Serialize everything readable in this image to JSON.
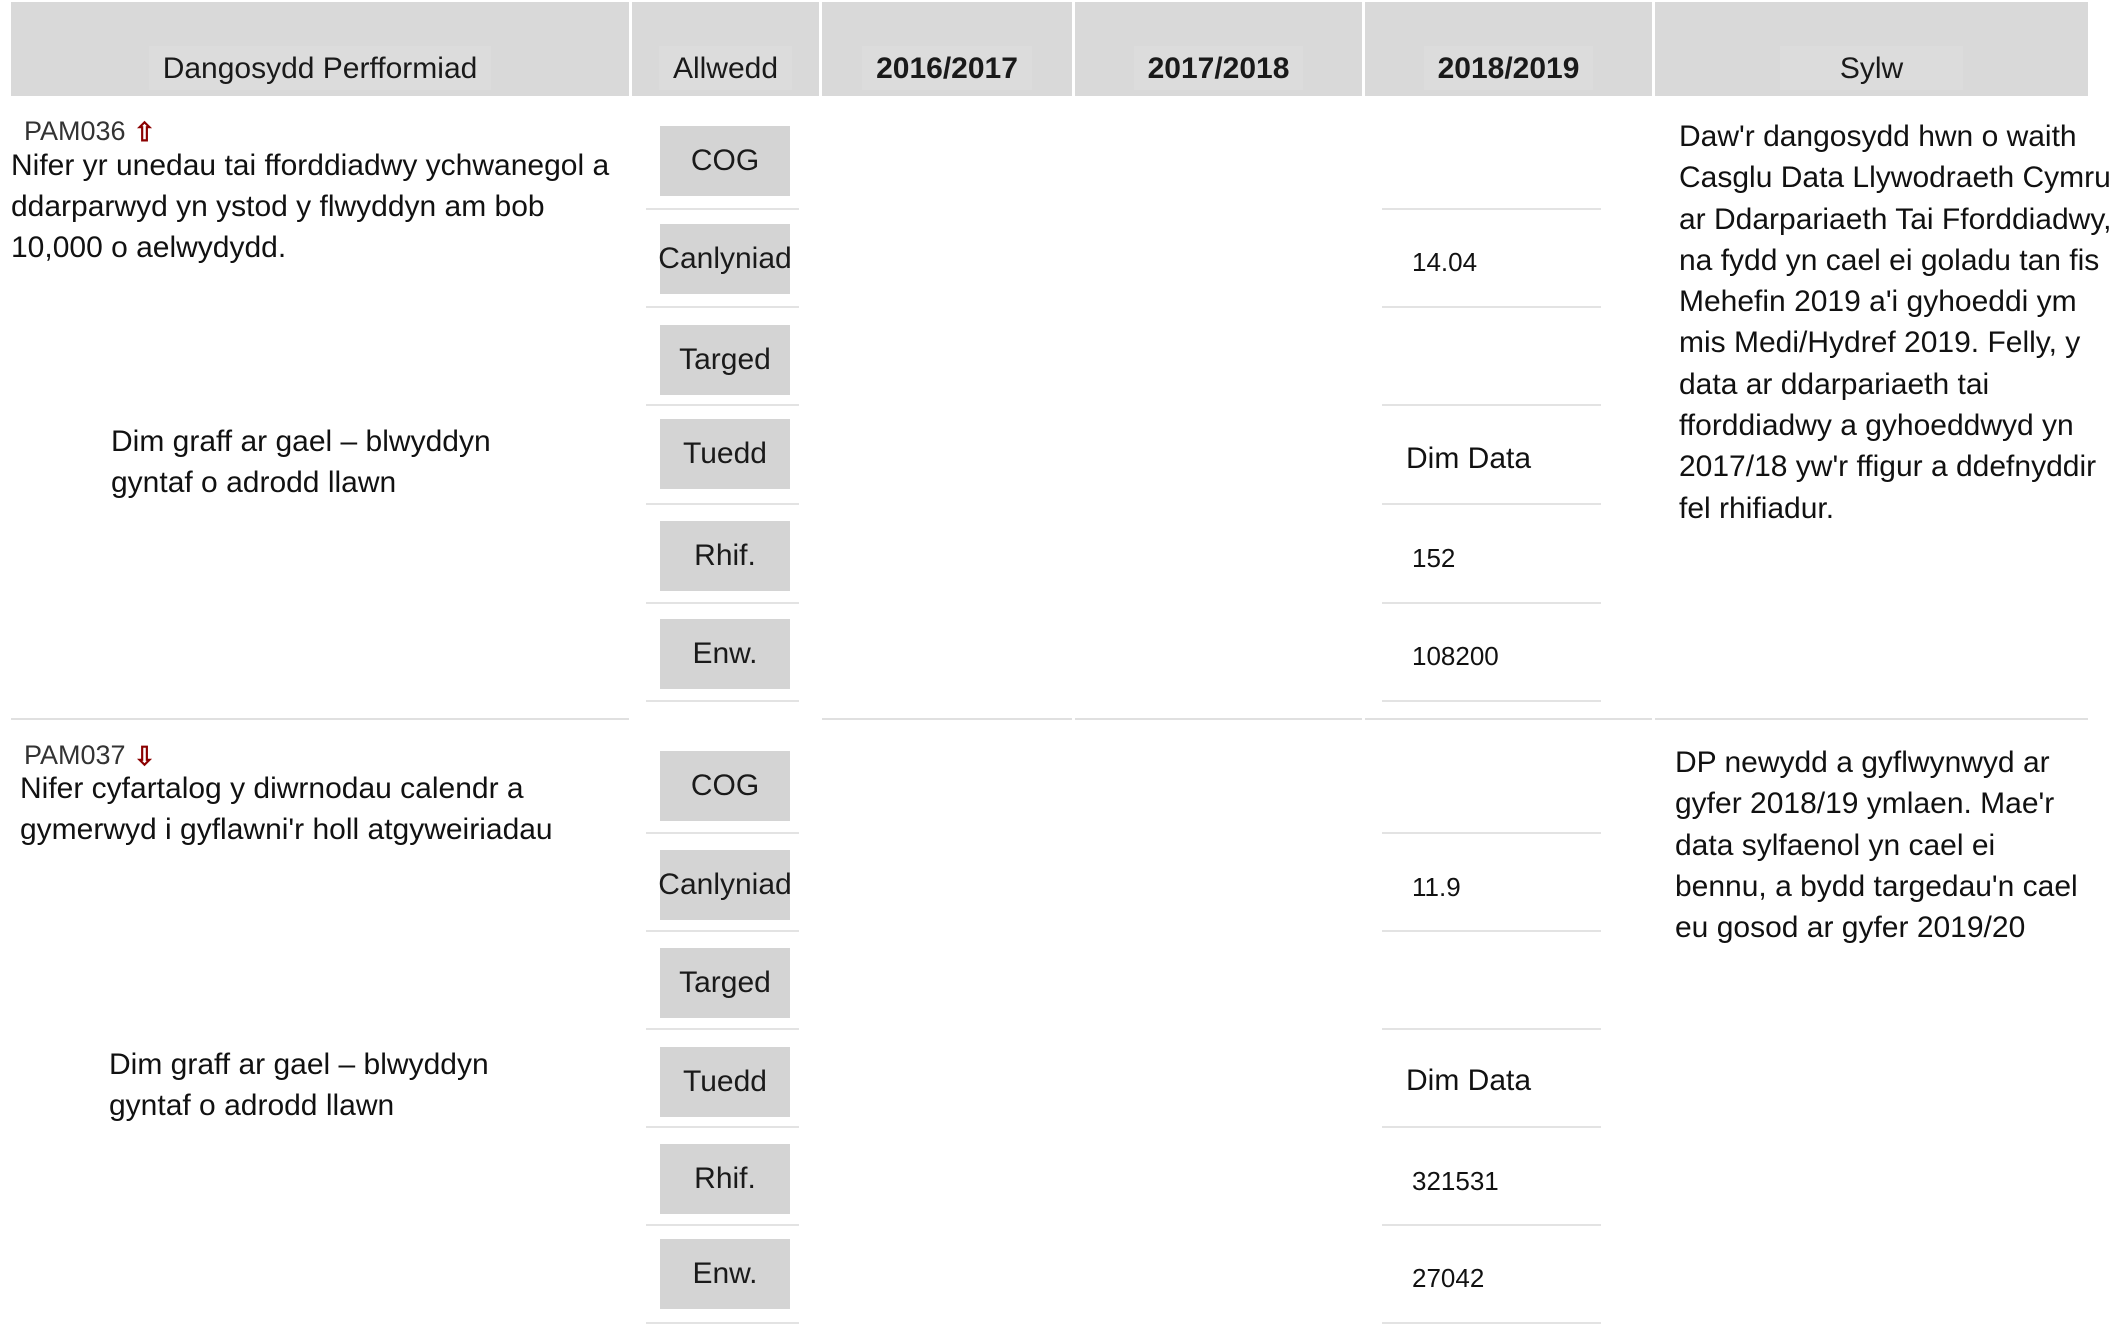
{
  "header": {
    "indicator": "Dangosydd Perfformiad",
    "key": "Allwedd",
    "y1": "2016/2017",
    "y2": "2017/2018",
    "y3": "2018/2019",
    "comment": "Sylw"
  },
  "rows": [
    {
      "code": "PAM036",
      "trend_arrow": "up-arrow-icon",
      "description": "Nifer yr unedau tai fforddiadwy ychwanegol a ddarparwyd yn ystod y flwyddyn am bob 10,000 o aelwydydd.",
      "no_graph": "Dim graff ar gael – blwyddyn gyntaf o adrodd llawn",
      "keys": [
        "COG",
        "Canlyniad",
        "Targed",
        "Tuedd",
        "Rhif.",
        "Enw."
      ],
      "values_2018_2019": [
        "",
        "14.04",
        "",
        "Dim Data",
        "152",
        "108200"
      ],
      "comment": "Daw'r dangosydd hwn o waith Casglu Data Llywodraeth Cymru ar Ddarpariaeth Tai Fforddiadwy, na fydd yn cael ei goladu tan fis Mehefin 2019 a'i gyhoeddi ym mis Medi/Hydref 2019. Felly, y data ar ddarpariaeth tai fforddiadwy a gyhoeddwyd yn 2017/18 yw'r ffigur a ddefnyddir fel rhifiadur."
    },
    {
      "code": "PAM037",
      "trend_arrow": "down-arrow-icon",
      "description": "Nifer cyfartalog y diwrnodau calendr a gymerwyd i gyflawni'r holl atgyweiriadau",
      "no_graph": "Dim graff ar gael – blwyddyn gyntaf o adrodd llawn",
      "keys": [
        "COG",
        "Canlyniad",
        "Targed",
        "Tuedd",
        "Rhif.",
        "Enw."
      ],
      "values_2018_2019": [
        "",
        "11.9",
        "",
        "Dim Data",
        "321531",
        "27042"
      ],
      "comment": "DP newydd a gyflwynwyd ar gyfer 2018/19 ymlaen. Mae'r data sylfaenol yn cael ei bennu, a bydd targedau'n cael eu gosod ar gyfer 2019/20"
    }
  ],
  "colors": {
    "header_bg": "#d9d9d9",
    "key_bg": "#d4d4d4",
    "arrow": "#8b0000"
  }
}
